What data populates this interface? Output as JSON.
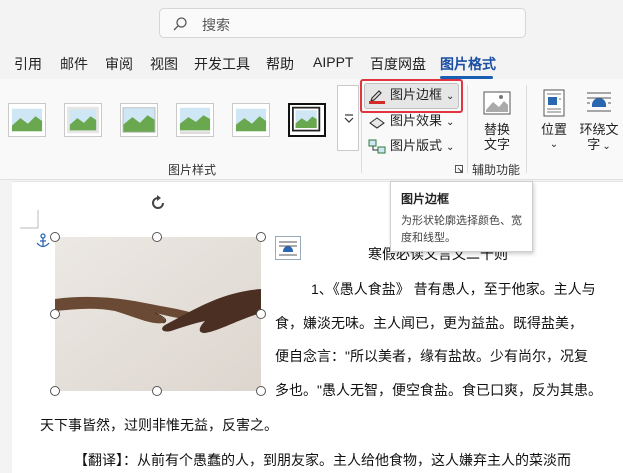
{
  "search": {
    "placeholder": "搜索"
  },
  "tabs": [
    {
      "label": "引用"
    },
    {
      "label": "邮件"
    },
    {
      "label": "审阅"
    },
    {
      "label": "视图"
    },
    {
      "label": "开发工具"
    },
    {
      "label": "帮助"
    },
    {
      "label": "AIPPT"
    },
    {
      "label": "百度网盘"
    },
    {
      "label": "图片格式",
      "active": true
    }
  ],
  "ribbon": {
    "picture_styles_label": "图片样式",
    "picture_border": "图片边框",
    "picture_effects": "图片效果",
    "picture_layout": "图片版式",
    "alt_text": "替换文字",
    "alt_text_line1": "替换",
    "alt_text_line2": "文字",
    "accessibility_label": "辅助功能",
    "position": "位置",
    "wrap_text_line1": "环绕文",
    "wrap_text_line2": "字"
  },
  "tooltip": {
    "title": "图片边框",
    "description": "为形状轮廓选择颜色、宽度和线型。"
  },
  "document": {
    "heading": "寒假必读文言文二十则",
    "lines": [
      "1、《愚人食盐》 昔有愚人，至于他家。主人与",
      "食，嫌淡无味。主人闻已，更为益盐。既得盐美，",
      "便自念言：\"所以美者，缘有盐故。少有尚尔，况复",
      "多也。\"愚人无智，便空食盐。食已口爽，反为其患。",
      "天下事皆然，过则非惟无益，反害之。",
      "【翻译】：从前有个愚蠢的人，到朋友家。主人给他食物，这人嫌弃主人的菜淡而"
    ]
  },
  "colors": {
    "accent": "#1a4fa3",
    "highlight_box": "#e0343f",
    "border_pen_red": "#d42a2a"
  }
}
